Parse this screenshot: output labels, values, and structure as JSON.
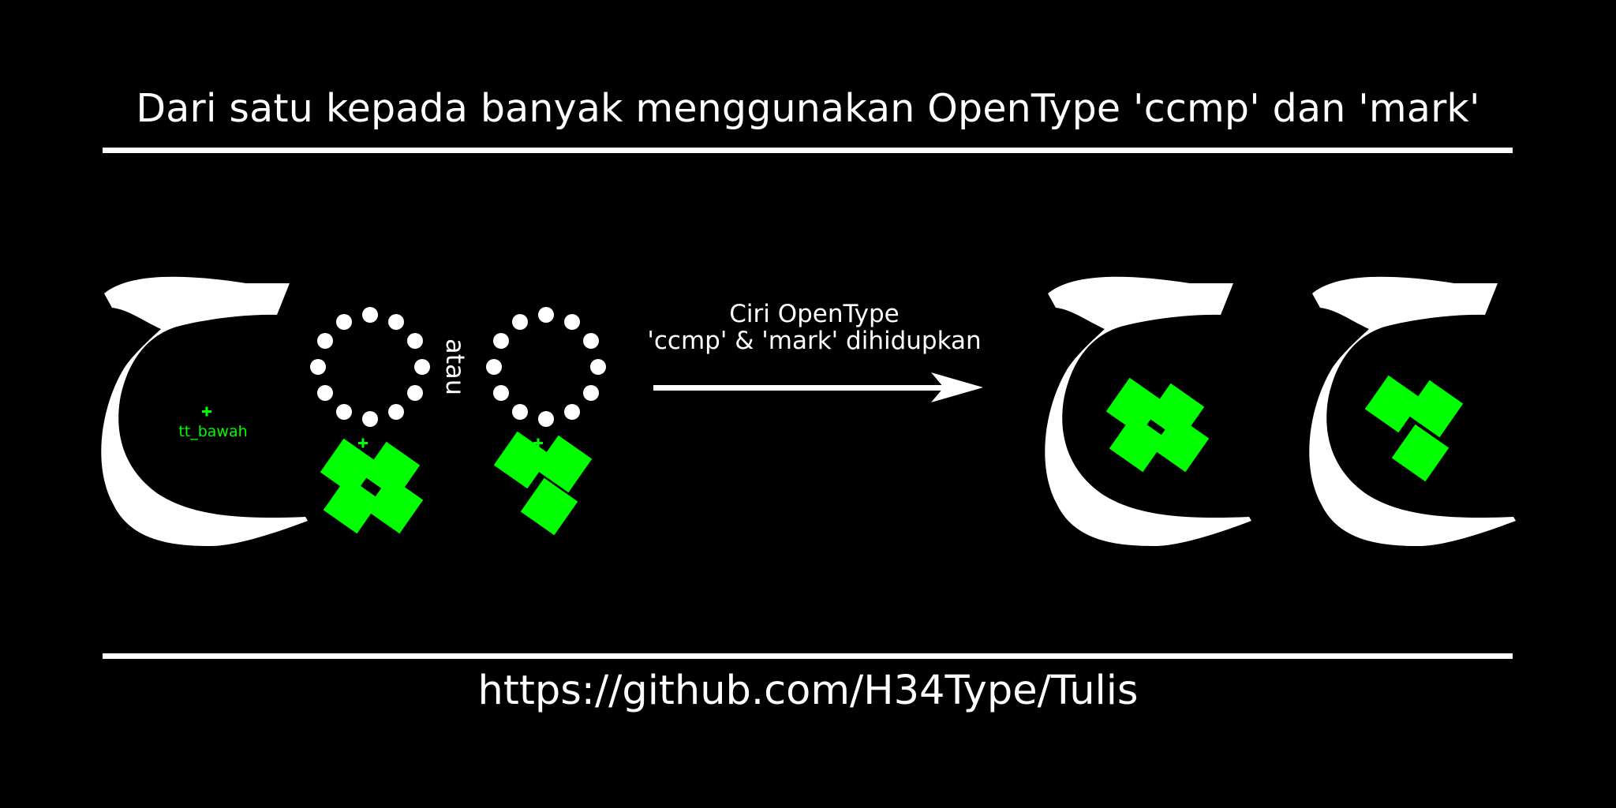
{
  "title": "Dari satu kepada banyak menggunakan OpenType 'ccmp' dan 'mark'",
  "anchor_label": "tt_bawah",
  "or_label": "atau",
  "arrow_label_line1": "Ciri OpenType",
  "arrow_label_line2": "'ccmp' & 'mark' dihidupkan",
  "footer_url": "https://github.com/H34Type/Tulis",
  "colors": {
    "background": "#000000",
    "foreground": "#ffffff",
    "accent": "#00ff00"
  }
}
